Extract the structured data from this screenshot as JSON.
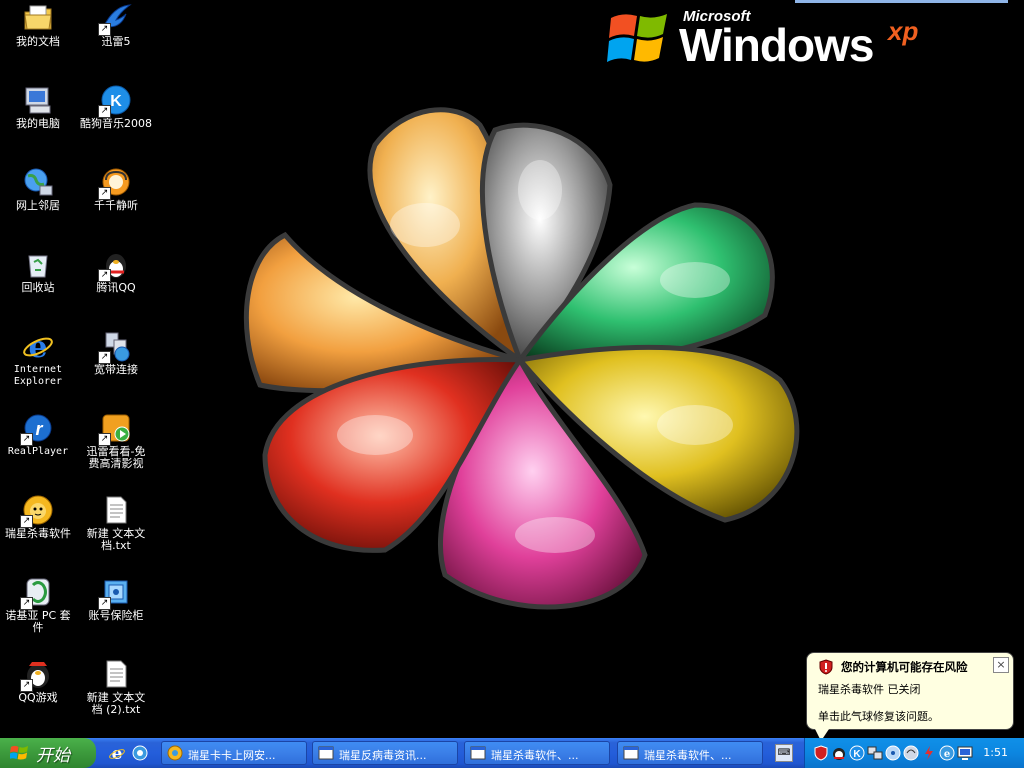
{
  "desktop": {
    "icons": [
      {
        "label": "我的文档",
        "icon": "my-documents-icon"
      },
      {
        "label": "迅雷5",
        "icon": "thunder-icon"
      },
      {
        "label": "我的电脑",
        "icon": "my-computer-icon"
      },
      {
        "label": "酷狗音乐2008",
        "icon": "kugou-music-icon"
      },
      {
        "label": "网上邻居",
        "icon": "network-places-icon"
      },
      {
        "label": "千千静听",
        "icon": "ttplayer-icon"
      },
      {
        "label": "回收站",
        "icon": "recycle-bin-icon"
      },
      {
        "label": "腾讯QQ",
        "icon": "qq-penguin-icon"
      },
      {
        "label": "Internet\nExplorer",
        "icon": "internet-explorer-icon"
      },
      {
        "label": "宽带连接",
        "icon": "broadband-connection-icon"
      },
      {
        "label": "RealPlayer",
        "icon": "realplayer-icon"
      },
      {
        "label": "迅雷看看-免\n费高清影视",
        "icon": "xunlei-kankan-icon"
      },
      {
        "label": "瑞星杀毒软件",
        "icon": "rising-antivirus-lion-icon"
      },
      {
        "label": "新建 文本文\n档.txt",
        "icon": "text-document-icon"
      },
      {
        "label": "诺基亚 PC 套\n件",
        "icon": "nokia-pc-suite-icon"
      },
      {
        "label": "账号保险柜",
        "icon": "account-safe-icon"
      },
      {
        "label": "QQ游戏",
        "icon": "qq-game-icon"
      },
      {
        "label": "新建 文本文\n档 (2).txt",
        "icon": "text-document-icon"
      }
    ]
  },
  "wallpaper": {
    "logo_small": "Microsoft",
    "logo_big": "Windows",
    "logo_xp": "xp"
  },
  "balloon": {
    "title": "您的计算机可能存在风险",
    "line1": "瑞星杀毒软件 已关闭",
    "line2": "单击此气球修复该问题。",
    "close": "×"
  },
  "taskbar": {
    "start_label": "开始",
    "tasks": [
      {
        "label": "瑞星卡卡上网安..."
      },
      {
        "label": "瑞星反病毒资讯..."
      },
      {
        "label": "瑞星杀毒软件、..."
      },
      {
        "label": "瑞星杀毒软件、..."
      }
    ],
    "clock": "1:51"
  },
  "colors": {
    "taskbar_blue": "#245edb",
    "start_green": "#3c9a3c",
    "tray_blue": "#0c86e0",
    "balloon_bg": "#ffffe1"
  }
}
